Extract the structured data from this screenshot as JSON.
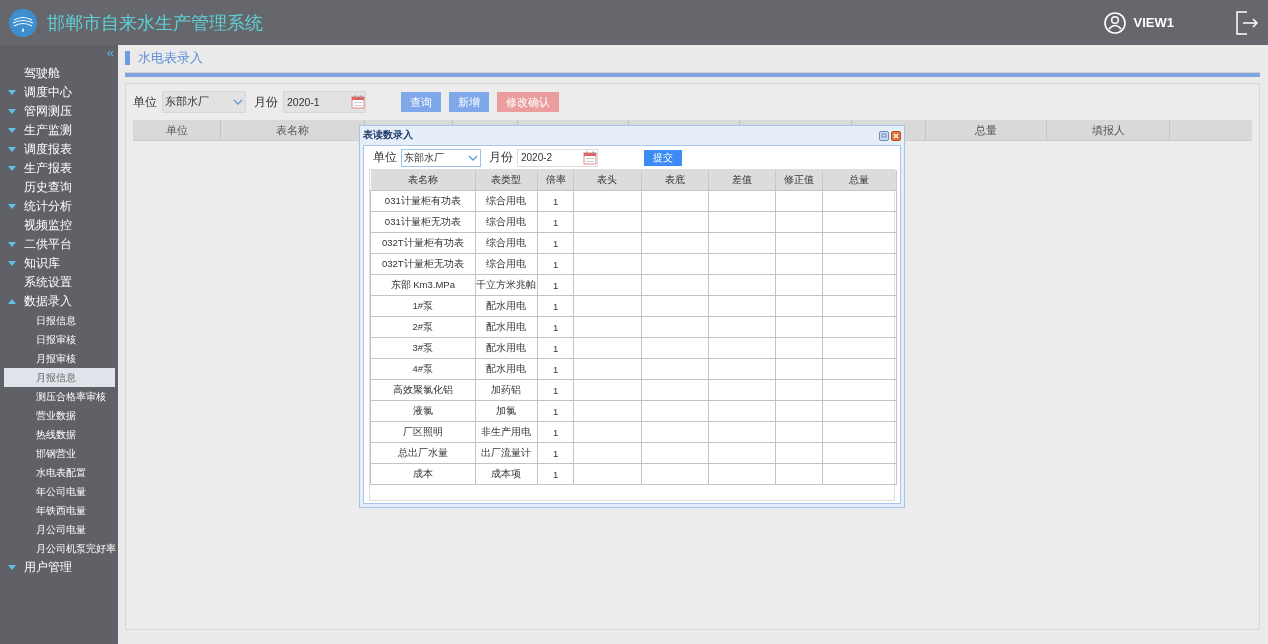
{
  "app": {
    "title": "邯郸市自来水生产管理系统",
    "user": "VIEW1"
  },
  "sidebar": {
    "collapse": "«",
    "items": [
      {
        "label": "驾驶舱",
        "kind": "link"
      },
      {
        "label": "调度中心",
        "kind": "group",
        "expanded": false
      },
      {
        "label": "管网测压",
        "kind": "group",
        "expanded": false
      },
      {
        "label": "生产监测",
        "kind": "group",
        "expanded": false
      },
      {
        "label": "调度报表",
        "kind": "group",
        "expanded": false
      },
      {
        "label": "生产报表",
        "kind": "group",
        "expanded": false
      },
      {
        "label": "历史查询",
        "kind": "link"
      },
      {
        "label": "统计分析",
        "kind": "group",
        "expanded": false
      },
      {
        "label": "视频监控",
        "kind": "link"
      },
      {
        "label": "二供平台",
        "kind": "group",
        "expanded": false
      },
      {
        "label": "知识库",
        "kind": "group",
        "expanded": false
      },
      {
        "label": "系统设置",
        "kind": "link"
      },
      {
        "label": "数据录入",
        "kind": "group",
        "expanded": true,
        "children": [
          {
            "label": "日报信息",
            "selected": false
          },
          {
            "label": "日报审核",
            "selected": false
          },
          {
            "label": "月报审核",
            "selected": false
          },
          {
            "label": "月报信息",
            "selected": true
          },
          {
            "label": "测压合格率审核",
            "selected": false
          },
          {
            "label": "营业数据",
            "selected": false
          },
          {
            "label": "热线数据",
            "selected": false
          },
          {
            "label": "邯钢营业",
            "selected": false
          },
          {
            "label": "水电表配置",
            "selected": false
          },
          {
            "label": "年公司电量",
            "selected": false
          },
          {
            "label": "年铁西电量",
            "selected": false
          },
          {
            "label": "月公司电量",
            "selected": false
          },
          {
            "label": "月公司机泵完好率",
            "selected": false
          }
        ]
      },
      {
        "label": "用户管理",
        "kind": "group",
        "expanded": false
      }
    ]
  },
  "page": {
    "title": "水电表录入",
    "unit_label": "单位",
    "unit_value": "东部水厂",
    "month_label": "月份",
    "month_value": "2020-1",
    "buttons": [
      {
        "label": "查询",
        "kind": "primary"
      },
      {
        "label": "新增",
        "kind": "primary"
      },
      {
        "label": "修改确认",
        "kind": "danger"
      }
    ],
    "table": {
      "columns_left": [
        "单位",
        "表名称"
      ],
      "columns_right": [
        "总量",
        "填报人"
      ]
    }
  },
  "dialog": {
    "title": "表读数录入",
    "unit_label": "单位",
    "unit_value": "东部水厂",
    "month_label": "月份",
    "month_value": "2020-2",
    "submit": "提交",
    "table": {
      "columns": [
        "表名称",
        "表类型",
        "倍率",
        "表头",
        "表底",
        "差值",
        "修正值",
        "总量"
      ],
      "rows": [
        [
          "031计量柜有功表",
          "综合用电",
          "1"
        ],
        [
          "031计量柜无功表",
          "综合用电",
          "1"
        ],
        [
          "032T计量柜有功表",
          "综合用电",
          "1"
        ],
        [
          "032T计量柜无功表",
          "综合用电",
          "1"
        ],
        [
          "东部 Km3.MPa",
          "千立方米兆帕",
          "1"
        ],
        [
          "1#泵",
          "配水用电",
          "1"
        ],
        [
          "2#泵",
          "配水用电",
          "1"
        ],
        [
          "3#泵",
          "配水用电",
          "1"
        ],
        [
          "4#泵",
          "配水用电",
          "1"
        ],
        [
          "高效聚氯化铝",
          "加药铝",
          "1"
        ],
        [
          "液氯",
          "加氯",
          "1"
        ],
        [
          "厂区照明",
          "非生产用电",
          "1"
        ],
        [
          "总出厂水量",
          "出厂流量计",
          "1"
        ],
        [
          "成本",
          "成本项",
          "1"
        ]
      ]
    }
  }
}
